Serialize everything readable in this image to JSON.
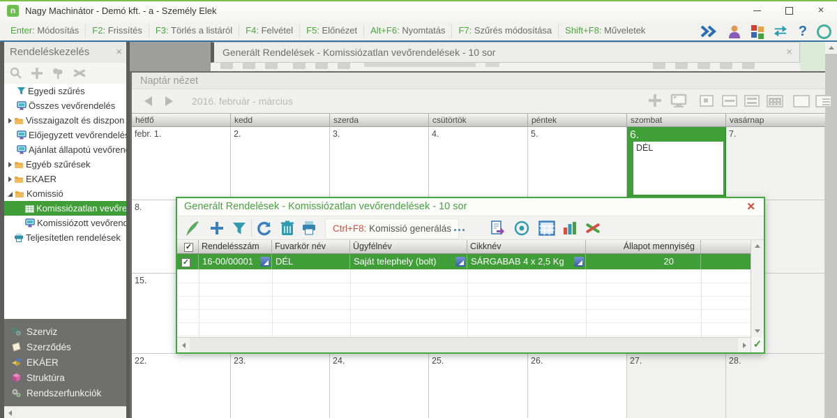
{
  "window": {
    "title": "Nagy Machinátor - Demó kft. - a - Személy Elek",
    "app_icon_letter": "n",
    "close_glyph": "×"
  },
  "shortcuts": [
    {
      "key": "Enter:",
      "label": "Módosítás"
    },
    {
      "key": "F2:",
      "label": "Frissítés"
    },
    {
      "key": "F3:",
      "label": "Törlés a listáról"
    },
    {
      "key": "F4:",
      "label": "Felvétel"
    },
    {
      "key": "F5:",
      "label": "Előnézet"
    },
    {
      "key": "Alt+F6:",
      "label": "Nyomtatás"
    },
    {
      "key": "F7:",
      "label": "Szűrés módosítása"
    },
    {
      "key": "Shift+F8:",
      "label": "Műveletek"
    }
  ],
  "header_icons": [
    "expand-chevrons-icon",
    "user-icon",
    "modules-grid-icon",
    "sync-arrows-icon",
    "help-icon",
    "status-circle-icon"
  ],
  "header_help_glyph": "?",
  "left_panel": {
    "title": "Rendeléskezelés",
    "close_glyph": "×",
    "tool_icons": [
      "search-icon",
      "add-icon",
      "tree-icon",
      "tools-icon"
    ],
    "tree": [
      {
        "label": "Egyedi szűrés",
        "icon": "filter-icon"
      },
      {
        "label": "Összes vevőrendelés",
        "icon": "monitor-icon"
      },
      {
        "label": "Visszaigazolt és diszpon",
        "icon": "folder-icon",
        "expander": "collapsed"
      },
      {
        "label": "Előjegyzett vevőrendelés",
        "icon": "monitor-icon"
      },
      {
        "label": "Ajánlat állapotú vevőrend",
        "icon": "monitor-icon"
      },
      {
        "label": "Egyéb szűrések",
        "icon": "folder-icon",
        "expander": "collapsed"
      },
      {
        "label": "EKAER",
        "icon": "folder-icon",
        "expander": "collapsed"
      },
      {
        "label": "Komissió",
        "icon": "folder-icon",
        "expander": "expanded"
      },
      {
        "label": "Komissiózatlan vevőre",
        "icon": "grid-icon",
        "selected": true
      },
      {
        "label": "Komissiózott vevőrend",
        "icon": "monitor-icon"
      },
      {
        "label": "Teljesítetlen rendelések",
        "icon": "printer-icon"
      }
    ],
    "bottom_items": [
      {
        "label": "Szerviz",
        "icon": "gears-icon"
      },
      {
        "label": "Szerződés",
        "icon": "document-icon"
      },
      {
        "label": "EKÁER",
        "icon": "transport-icon"
      },
      {
        "label": "Struktúra",
        "icon": "cube-icon"
      },
      {
        "label": "Rendszerfunkciók",
        "icon": "cogs-icon"
      }
    ]
  },
  "main_tab": {
    "title": "Generált Rendelések - Komissiózatlan vevőrendelések - 10 sor",
    "close_glyph": "×"
  },
  "calendar": {
    "title": "Naptár nézet",
    "period": "2016. február - március",
    "view_icons": [
      "add-icon",
      "monitor-icon",
      "day-view-icon",
      "week-view-icon",
      "two-week-view-icon",
      "month-view-icon",
      "blank-view-icon",
      "list-view-icon"
    ],
    "day_headers": [
      "hétfő",
      "kedd",
      "szerda",
      "csütörtök",
      "péntek",
      "szombat",
      "vasárnap"
    ],
    "weeks": [
      [
        "febr. 1.",
        "2.",
        "3.",
        "4.",
        "5.",
        "6.",
        "7."
      ],
      [
        "8.",
        "",
        "",
        "",
        "",
        "",
        ""
      ],
      [
        "15.",
        "",
        "",
        "",
        "",
        "",
        ""
      ],
      [
        "22.",
        "23.",
        "24.",
        "25.",
        "26.",
        "27.",
        "28."
      ]
    ],
    "selected_day": "6.",
    "selected_entry": "DÉL"
  },
  "dialog": {
    "title": "Generált Rendelések - Komissiózatlan vevőrendelések - 10 sor",
    "close_glyph": "✕",
    "toolbar_icons": [
      "edit-pencil-icon",
      "add-icon",
      "filter-icon",
      "refresh-icon",
      "delete-icon",
      "print-icon",
      "export-icon",
      "view-icon",
      "table-icon",
      "chart-icon",
      "pin-tools-icon"
    ],
    "generate_key": "Ctrl+F8:",
    "generate_label": "Komissió generálás",
    "more_label": "...",
    "table": {
      "headers": [
        "Rendelésszám",
        "Fuvarkör név",
        "Ügyfélnév",
        "Cikknév",
        "Állapot mennyiség"
      ],
      "row": {
        "rendelesszam": "16-00/00001",
        "fuvarkor_nev": "DÉL",
        "ugyfelnev": "Saját telephely (bolt)",
        "cikknev": "SÁRGABAB 4 x 2,5 Kg",
        "allapot_mennyiseg": "20"
      }
    },
    "confirm_glyph": "✓"
  }
}
